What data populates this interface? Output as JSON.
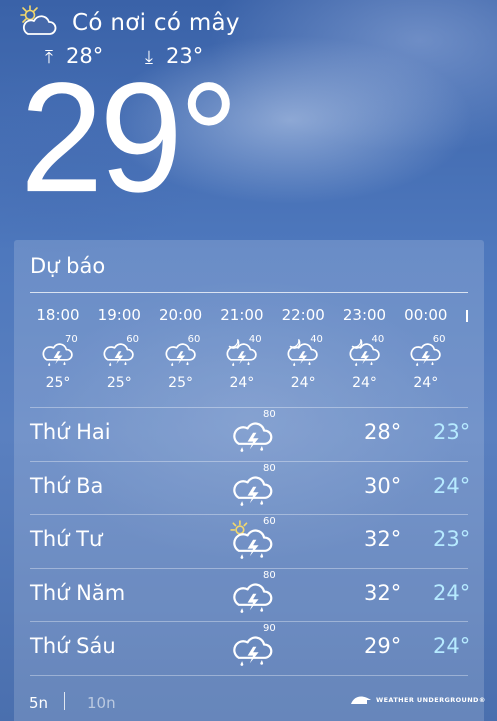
{
  "current": {
    "condition": "Có nơi có mây",
    "condition_icon": "partly-cloudy-sun-icon",
    "high": "28°",
    "low": "23°",
    "temperature": "29°"
  },
  "forecast": {
    "title": "Dự báo",
    "hourly": [
      {
        "time": "18:00",
        "precip": "70",
        "icon": "thunderstorm-icon",
        "temp": "25°"
      },
      {
        "time": "19:00",
        "precip": "60",
        "icon": "thunderstorm-icon",
        "temp": "25°"
      },
      {
        "time": "20:00",
        "precip": "60",
        "icon": "thunderstorm-icon",
        "temp": "25°"
      },
      {
        "time": "21:00",
        "precip": "40",
        "icon": "night-thunderstorm-icon",
        "temp": "24°"
      },
      {
        "time": "22:00",
        "precip": "40",
        "icon": "night-thunderstorm-icon",
        "temp": "24°"
      },
      {
        "time": "23:00",
        "precip": "40",
        "icon": "night-thunderstorm-icon",
        "temp": "24°"
      },
      {
        "time": "00:00",
        "precip": "60",
        "icon": "thunderstorm-icon",
        "temp": "24°"
      }
    ],
    "daily": [
      {
        "day": "Thứ Hai",
        "precip": "80",
        "icon": "thunderstorm-icon",
        "high": "28°",
        "low": "23°"
      },
      {
        "day": "Thứ Ba",
        "precip": "80",
        "icon": "thunderstorm-icon",
        "high": "30°",
        "low": "24°"
      },
      {
        "day": "Thứ Tư",
        "precip": "60",
        "icon": "sun-thunderstorm-icon",
        "high": "32°",
        "low": "23°"
      },
      {
        "day": "Thứ Năm",
        "precip": "80",
        "icon": "thunderstorm-icon",
        "high": "32°",
        "low": "24°"
      },
      {
        "day": "Thứ Sáu",
        "precip": "90",
        "icon": "thunderstorm-icon",
        "high": "29°",
        "low": "24°"
      }
    ]
  },
  "footer": {
    "range_5": "5n",
    "range_10": "10n",
    "provider": "WEATHER UNDERGROUND®"
  },
  "colors": {
    "low_temp": "#b6eaff",
    "sun": "#f3d86b"
  }
}
